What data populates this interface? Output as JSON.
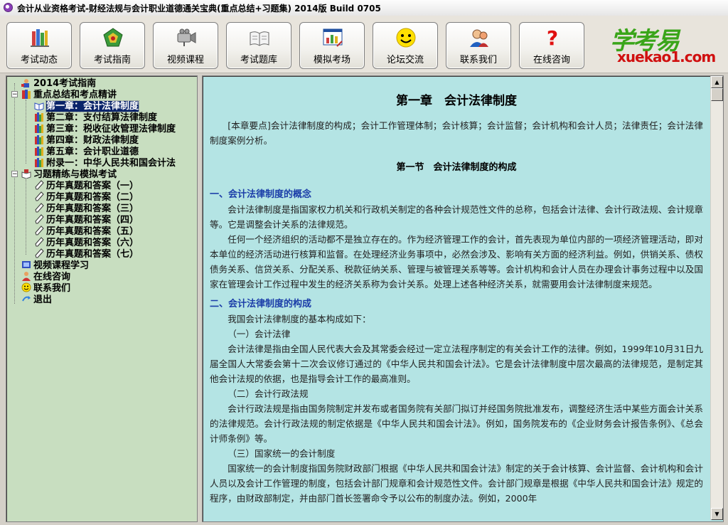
{
  "window": {
    "title": "会计从业资格考试-财经法规与会计职业道德通关宝典(重点总结+习题集) 2014版 Build 0705"
  },
  "toolbar": {
    "buttons": [
      {
        "label": "考试动态",
        "icon": "bookshelf-icon"
      },
      {
        "label": "考试指南",
        "icon": "compass-icon"
      },
      {
        "label": "视频课程",
        "icon": "video-camera-icon"
      },
      {
        "label": "考试题库",
        "icon": "open-book-icon"
      },
      {
        "label": "模拟考场",
        "icon": "chart-window-icon"
      },
      {
        "label": "论坛交流",
        "icon": "smiley-icon"
      },
      {
        "label": "联系我们",
        "icon": "contact-person-icon"
      },
      {
        "label": "在线咨询",
        "icon": "question-mark-icon"
      }
    ]
  },
  "logo": {
    "cn": "学考易",
    "en": "xuekao1.com"
  },
  "tree": {
    "items": [
      {
        "label": "2014考试指南",
        "icon": "guide-icon"
      },
      {
        "label": "重点总结和考点精讲",
        "icon": "books-icon",
        "expander": "−"
      },
      {
        "label": "第一章：会计法律制度",
        "icon": "open-book-icon",
        "selected": true
      },
      {
        "label": "第二章：支付结算法律制度",
        "icon": "book-icon"
      },
      {
        "label": "第三章：税收征收管理法律制度",
        "icon": "book-icon"
      },
      {
        "label": "第四章：财政法律制度",
        "icon": "book-icon"
      },
      {
        "label": "第五章：会计职业道德",
        "icon": "book-icon"
      },
      {
        "label": "附录一：中华人民共和国会计法",
        "icon": "book-icon"
      },
      {
        "label": "习题精练与模拟考试",
        "icon": "exercise-icon",
        "expander": "−"
      },
      {
        "label": "历年真题和答案（一）",
        "icon": "pencil-icon"
      },
      {
        "label": "历年真题和答案（二）",
        "icon": "pencil-icon"
      },
      {
        "label": "历年真题和答案（三）",
        "icon": "pencil-icon"
      },
      {
        "label": "历年真题和答案（四）",
        "icon": "pencil-icon"
      },
      {
        "label": "历年真题和答案（五）",
        "icon": "pencil-icon"
      },
      {
        "label": "历年真题和答案（六）",
        "icon": "pencil-icon"
      },
      {
        "label": "历年真题和答案（七）",
        "icon": "pencil-icon"
      },
      {
        "label": "视频课程学习",
        "icon": "film-icon"
      },
      {
        "label": "在线咨询",
        "icon": "person-icon"
      },
      {
        "label": "联系我们",
        "icon": "smiley-icon"
      },
      {
        "label": "退出",
        "icon": "exit-icon"
      }
    ]
  },
  "content": {
    "chapter_title": "第一章　会计法律制度",
    "key_points": "[本章要点]会计法律制度的构成；会计工作管理体制；会计核算；会计监督；会计机构和会计人员；法律责任；会计法律制度案例分析。",
    "section_title": "第一节　会计法律制度的构成",
    "h1": "一、会计法律制度的概念",
    "p1": "会计法律制度是指国家权力机关和行政机关制定的各种会计规范性文件的总称，包括会计法律、会计行政法规、会计规章等。它是调整会计关系的法律规范。",
    "p2": "任何一个经济组织的活动都不是独立存在的。作为经济管理工作的会计，首先表现为单位内部的一项经济管理活动，即对本单位的经济活动进行核算和监督。在处理经济业务事项中，必然会涉及、影响有关方面的经济利益。例如，供销关系、债权债务关系、信贷关系、分配关系、税款征纳关系、管理与被管理关系等等。会计机构和会计人员在办理会计事务过程中以及国家在管理会计工作过程中发生的经济关系称为会计关系。处理上述各种经济关系，就需要用会计法律制度来规范。",
    "h2": "二、会计法律制度的构成",
    "p3": "我国会计法律制度的基本构成如下：",
    "s1": "（一）会计法律",
    "p4": "会计法律是指由全国人民代表大会及其常委会经过一定立法程序制定的有关会计工作的法律。例如，1999年10月31日九届全国人大常委会第十二次会议修订通过的《中华人民共和国会计法》。它是会计法律制度中层次最高的法律规范，是制定其他会计法规的依据，也是指导会计工作的最高准则。",
    "s2": "（二）会计行政法规",
    "p5": "会计行政法规是指由国务院制定并发布或者国务院有关部门拟订并经国务院批准发布，调整经济生活中某些方面会计关系的法律规范。会计行政法规的制定依据是《中华人民共和国会计法》。例如，国务院发布的《企业财务会计报告条例》、《总会计师条例》等。",
    "s3": "（三）国家统一的会计制度",
    "p6": "国家统一的会计制度指国务院财政部门根据《中华人民共和国会计法》制定的关于会计核算、会计监督、会计机构和会计人员以及会计工作管理的制度，包括会计部门规章和会计规范性文件。会计部门规章是根据《中华人民共和国会计法》规定的程序，由财政部制定，并由部门首长签署命令予以公布的制度办法。例如，2000年"
  },
  "colors": {
    "sidebar_bg": "#c8dec0",
    "content_bg": "#b4e4e4",
    "heading_blue": "#1a3ca8",
    "selection": "#0a246a"
  }
}
